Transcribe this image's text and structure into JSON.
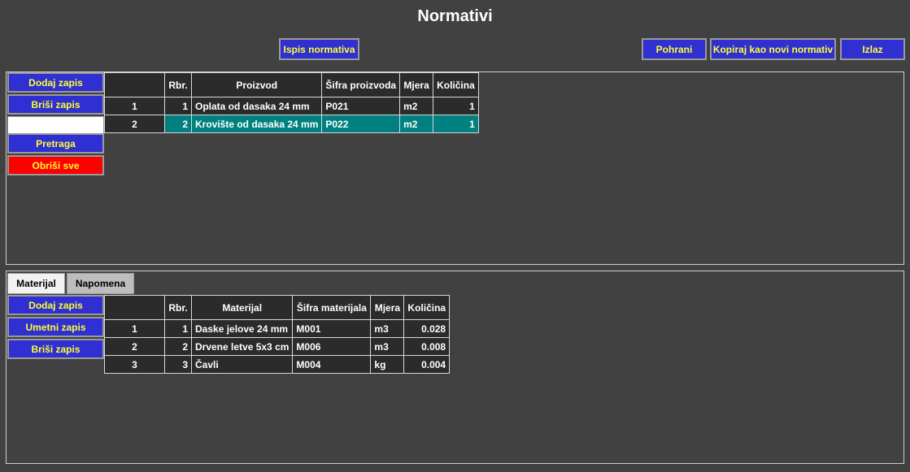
{
  "page": {
    "title": "Normativi"
  },
  "toolbar": {
    "print_label": "Ispis normativa",
    "save_label": "Pohrani",
    "copy_label": "Kopiraj kao novi normativ",
    "exit_label": "Izlaz"
  },
  "top_panel": {
    "add_label": "Dodaj zapis",
    "delete_label": "Briši zapis",
    "search_value": "",
    "search_label": "Pretraga",
    "clear_all_label": "Obriši sve",
    "columns": [
      "",
      "Rbr.",
      "Proizvod",
      "Šifra proizvoda",
      "Mjera",
      "Količina"
    ],
    "rows": [
      {
        "idx": "1",
        "rbr": "1",
        "name": "Oplata od dasaka 24 mm",
        "code": "P021",
        "unit": "m2",
        "qty": "1",
        "selected": false
      },
      {
        "idx": "2",
        "rbr": "2",
        "name": "Krovište od dasaka 24 mm",
        "code": "P022",
        "unit": "m2",
        "qty": "1",
        "selected": true
      }
    ]
  },
  "bottom_panel": {
    "tabs": [
      {
        "label": "Materijal",
        "active": true
      },
      {
        "label": "Napomena",
        "active": false
      }
    ],
    "add_label": "Dodaj zapis",
    "insert_label": "Umetni zapis",
    "delete_label": "Briši zapis",
    "columns": [
      "",
      "Rbr.",
      "Materijal",
      "Šifra materijala",
      "Mjera",
      "Količina"
    ],
    "rows": [
      {
        "idx": "1",
        "rbr": "1",
        "name": "Daske jelove 24 mm",
        "code": "M001",
        "unit": "m3",
        "qty": "0.028"
      },
      {
        "idx": "2",
        "rbr": "2",
        "name": "Drvene letve 5x3 cm",
        "code": "M006",
        "unit": "m3",
        "qty": "0.008"
      },
      {
        "idx": "3",
        "rbr": "3",
        "name": "Čavli",
        "code": "M004",
        "unit": "kg",
        "qty": "0.004"
      }
    ]
  },
  "colors": {
    "background": "#414141",
    "button": "#2f2fd2",
    "button_text": "#ffff33",
    "danger": "#ff0000",
    "selected_row": "#008080"
  }
}
